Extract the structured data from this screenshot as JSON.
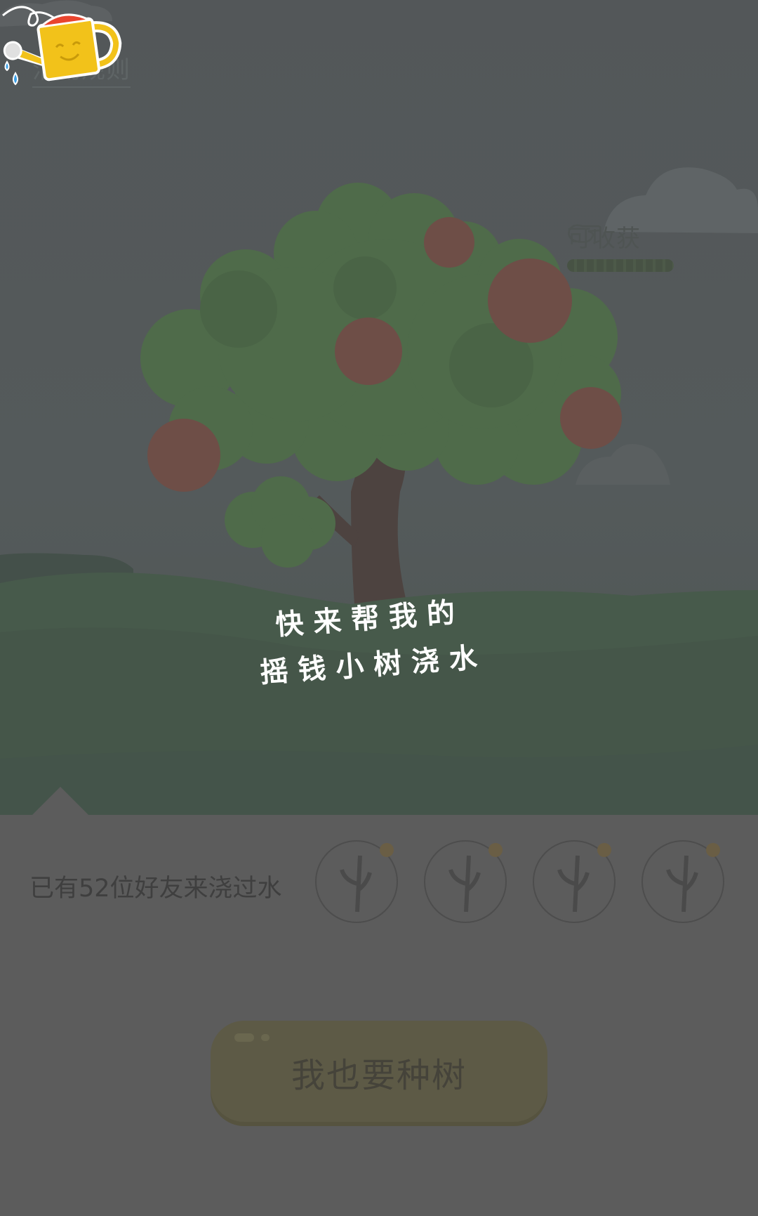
{
  "header": {
    "rules_label": "活动规则"
  },
  "harvest": {
    "label": "可收获",
    "progress": 1.0
  },
  "prompt": {
    "line1": "快来帮我的",
    "line2": "摇钱小树浇水"
  },
  "friends": {
    "count_text": "已有52位好友来浇过水",
    "avatars": [
      "avatar-1",
      "avatar-2",
      "avatar-3",
      "avatar-4"
    ]
  },
  "cta": {
    "label": "我也要种树"
  },
  "colors": {
    "overlay": "#5c5c5c",
    "can_yellow": "#f2c21a",
    "can_red": "#e9452f",
    "water_blue": "#3aa0e8"
  }
}
